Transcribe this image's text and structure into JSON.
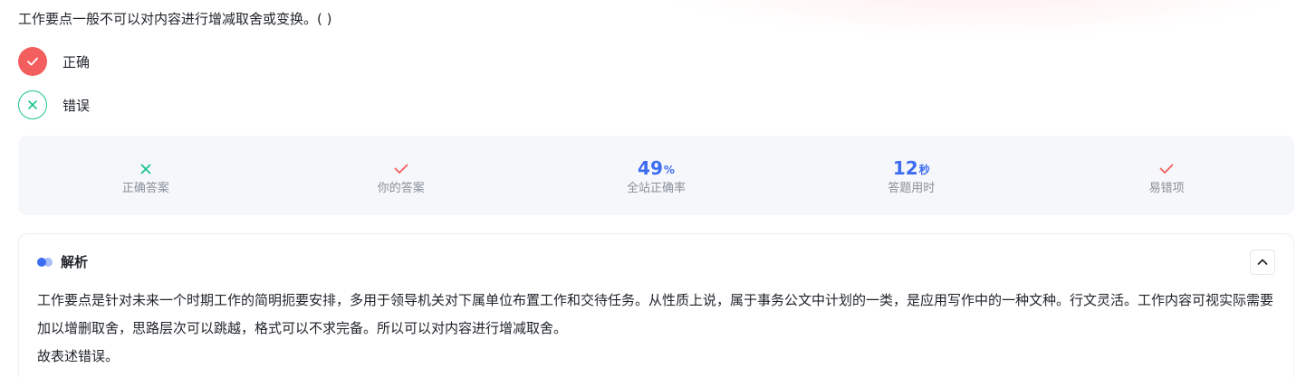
{
  "question": {
    "text": "工作要点一般不可以对内容进行增减取舍或变换。( )"
  },
  "options": [
    {
      "label": "正确",
      "icon": "check-icon",
      "state": "user-selected-wrong",
      "color": "#f35f5f"
    },
    {
      "label": "错误",
      "icon": "cross-icon",
      "state": "correct-answer",
      "color": "#1bc392"
    }
  ],
  "stats": {
    "correct_answer": {
      "icon": "cross-icon",
      "color": "#1bc392",
      "label": "正确答案"
    },
    "your_answer": {
      "icon": "check-icon",
      "color": "#f35f5f",
      "label": "你的答案"
    },
    "accuracy": {
      "value": "49",
      "unit": "%",
      "label": "全站正确率"
    },
    "time_used": {
      "value": "12",
      "unit": "秒",
      "label": "答题用时"
    },
    "error_prone": {
      "icon": "check-icon",
      "color": "#f35f5f",
      "label": "易错项"
    }
  },
  "analysis": {
    "title": "解析",
    "collapse_icon": "chevron-up-icon",
    "body_line1": "工作要点是针对未来一个时期工作的简明扼要安排，多用于领导机关对下属单位布置工作和交待任务。从性质上说，属于事务公文中计划的一类，是应用写作中的一种文种。行文灵活。工作内容可视实际需要加以增删取舍，思路层次可以跳越，格式可以不求完备。所以可以对内容进行增减取舍。",
    "body_line2": "故表述错误。"
  }
}
